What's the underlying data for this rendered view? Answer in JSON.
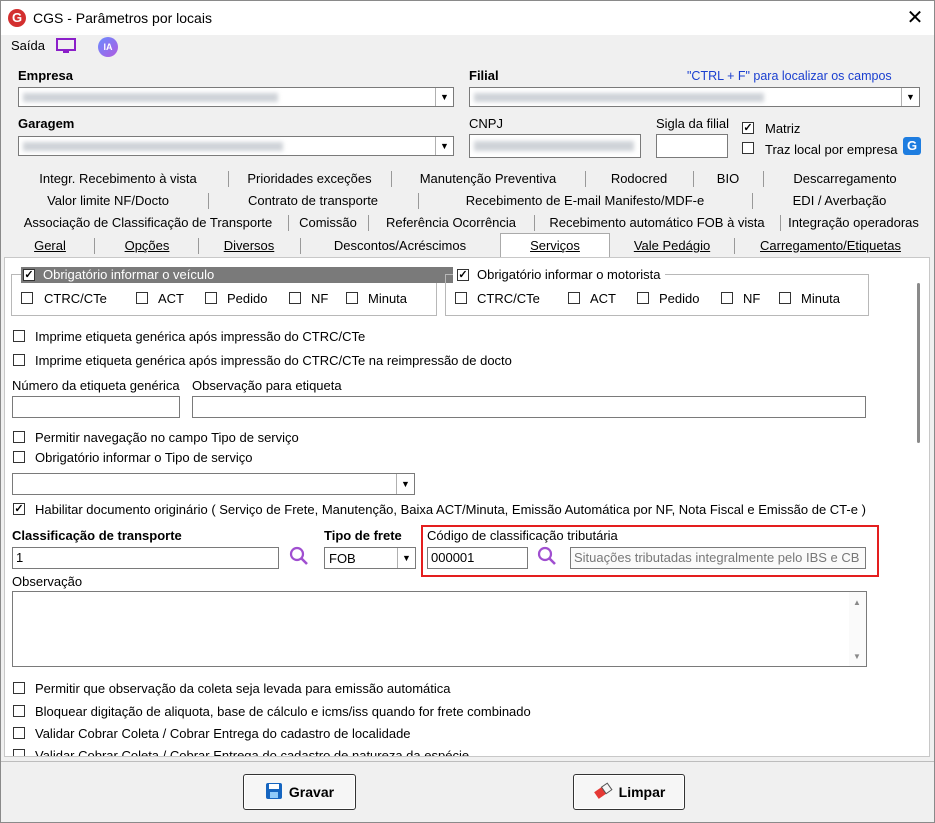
{
  "window": {
    "title": "CGS - Parâmetros por locais"
  },
  "toolbar": {
    "saida": "Saída",
    "ia": "IA"
  },
  "header": {
    "empresa_label": "Empresa",
    "filial_label": "Filial",
    "ctrl_hint": "\"CTRL + F\" para localizar os campos",
    "garagem_label": "Garagem",
    "cnpj_label": "CNPJ",
    "sigla_label": "Sigla da filial",
    "matriz_label": "Matriz",
    "traz_local_label": "Traz local por empresa"
  },
  "tabs": {
    "row1": [
      "Integr. Recebimento à vista",
      "Prioridades exceções",
      "Manutenção Preventiva",
      "Rodocred",
      "BIO",
      "Descarregamento"
    ],
    "row2": [
      "Valor limite NF/Docto",
      "Contrato de transporte",
      "Recebimento de E-mail Manifesto/MDF-e",
      "EDI / Averbação"
    ],
    "row3": [
      "Associação de Classificação de Transporte",
      "Comissão",
      "Referência Ocorrência",
      "Recebimento automático FOB à vista",
      "Integração operadoras"
    ],
    "row4": [
      "Geral",
      "Opções",
      "Diversos",
      "Descontos/Acréscimos",
      "Serviços",
      "Vale Pedágio",
      "Carregamento/Etiquetas"
    ]
  },
  "servicos": {
    "obrig_veiculo": "Obrigatório informar o veículo",
    "obrig_motorista": "Obrigatório informar o motorista",
    "doc_types": [
      "CTRC/CTe",
      "ACT",
      "Pedido",
      "NF",
      "Minuta"
    ],
    "imprime_etiqueta": "Imprime etiqueta genérica após impressão do CTRC/CTe",
    "imprime_etiqueta_reimp": "Imprime etiqueta genérica após impressão do CTRC/CTe na reimpressão de docto",
    "numero_etiqueta_label": "Número da etiqueta genérica",
    "obs_etiqueta_label": "Observação para etiqueta",
    "permitir_nav": "Permitir navegação no campo Tipo de serviço",
    "obrig_tipo_servico": "Obrigatório informar o Tipo de serviço",
    "habilitar_doc": "Habilitar documento originário ( Serviço de Frete, Manutenção, Baixa ACT/Minuta, Emissão Automática por NF, Nota Fiscal e Emissão de CT-e )",
    "class_transporte_label": "Classificação de transporte",
    "class_transporte_value": "1",
    "tipo_frete_label": "Tipo de frete",
    "tipo_frete_value": "FOB",
    "codigo_class_label": "Código de classificação tributária",
    "codigo_class_value": "000001",
    "codigo_class_desc": "Situações tributadas integralmente pelo IBS e CB",
    "observacao_label": "Observação",
    "permitir_obs_coleta": "Permitir que observação da coleta seja levada para emissão automática",
    "bloquear_aliquota": "Bloquear digitação de aliquota, base de cálculo e icms/iss quando for frete combinado",
    "validar_localidade": "Validar Cobrar Coleta / Cobrar Entrega do cadastro de localidade",
    "validar_natureza": "Validar Cobrar Coleta / Cobrar Entrega do cadastro de natureza da espécie"
  },
  "buttons": {
    "gravar": "Gravar",
    "limpar": "Limpar"
  }
}
